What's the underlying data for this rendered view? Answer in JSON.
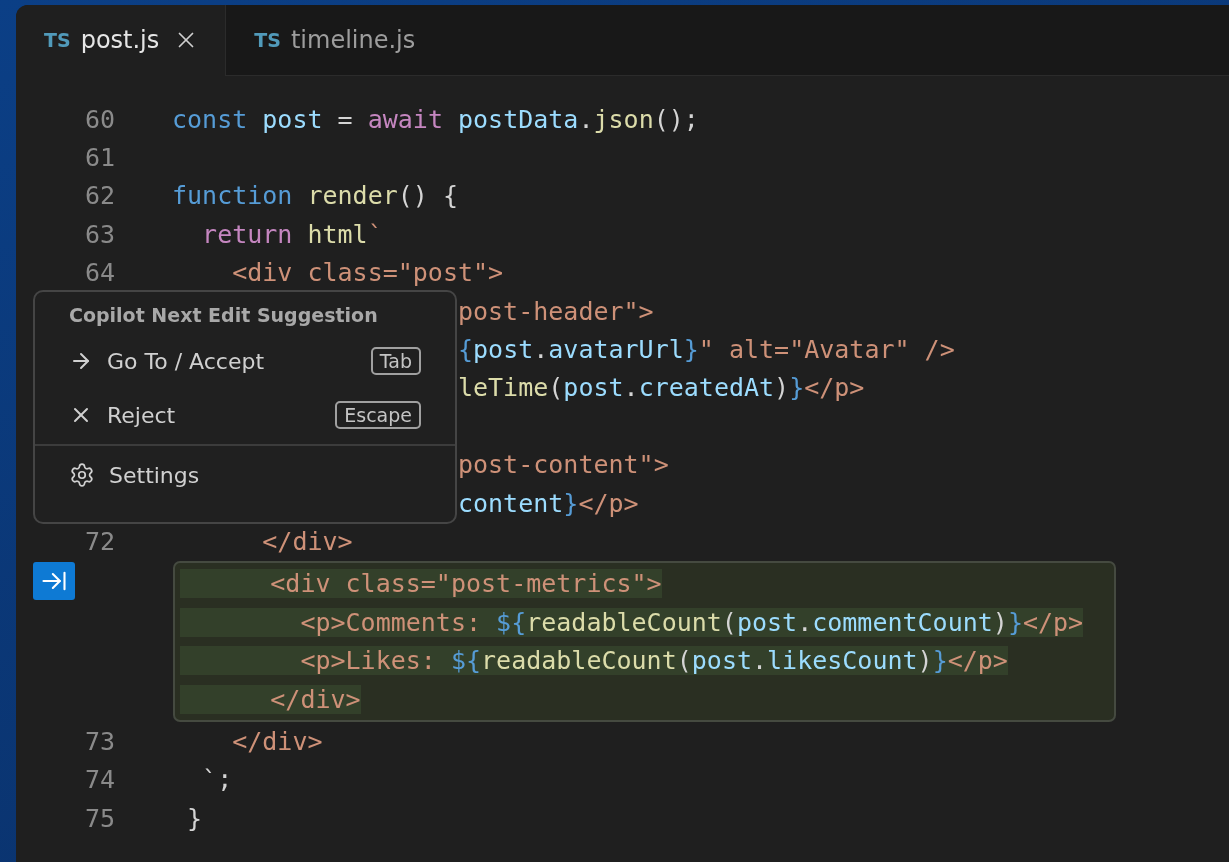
{
  "tabs": [
    {
      "badge": "TS",
      "label": "post.js",
      "selected": true
    },
    {
      "badge": "TS",
      "label": "timeline.js",
      "selected": false
    }
  ],
  "editor": {
    "lines_before": [
      {
        "number": "60",
        "tokens": [
          {
            "t": "const ",
            "color": "#569cd6"
          },
          {
            "t": "post",
            "color": "#9cdcfe"
          },
          {
            "t": " = ",
            "color": "#d4d4d4"
          },
          {
            "t": "await ",
            "color": "#c586c0"
          },
          {
            "t": "postData",
            "color": "#9cdcfe"
          },
          {
            "t": ".",
            "color": "#d4d4d4"
          },
          {
            "t": "json",
            "color": "#dcdcaa"
          },
          {
            "t": "();",
            "color": "#d4d4d4"
          }
        ]
      },
      {
        "number": "61"
      },
      {
        "number": "62",
        "tokens": [
          {
            "t": "function ",
            "color": "#569cd6"
          },
          {
            "t": "render",
            "color": "#dcdcaa"
          },
          {
            "t": "() {",
            "color": "#d4d4d4"
          }
        ]
      },
      {
        "number": "63",
        "tokens": [
          {
            "t": "  return ",
            "color": "#c586c0"
          },
          {
            "t": "html",
            "color": "#dcdcaa"
          },
          {
            "t": "`",
            "color": "#ce9178"
          }
        ]
      },
      {
        "number": "64",
        "tokens": [
          {
            "t": "    <div class=\"post\">",
            "color": "#ce9178"
          }
        ]
      },
      {
        "covered": true,
        "tokens": [
          {
            "t": "post-header\">",
            "color": "#ce9178"
          }
        ]
      },
      {
        "covered": true,
        "tokens": [
          {
            "t": "{",
            "color": "#569cd6"
          },
          {
            "t": "post",
            "color": "#9cdcfe"
          },
          {
            "t": ".",
            "color": "#d4d4d4"
          },
          {
            "t": "avatarUrl",
            "color": "#9cdcfe"
          },
          {
            "t": "}",
            "color": "#569cd6"
          },
          {
            "t": "\" alt=\"Avatar\" />",
            "color": "#ce9178"
          }
        ]
      },
      {
        "covered": true,
        "tokens": [
          {
            "t": "leTime",
            "color": "#dcdcaa"
          },
          {
            "t": "(",
            "color": "#d4d4d4"
          },
          {
            "t": "post",
            "color": "#9cdcfe"
          },
          {
            "t": ".",
            "color": "#d4d4d4"
          },
          {
            "t": "createdAt",
            "color": "#9cdcfe"
          },
          {
            "t": ")",
            "color": "#d4d4d4"
          },
          {
            "t": "}",
            "color": "#569cd6"
          },
          {
            "t": "</p>",
            "color": "#ce9178"
          }
        ]
      },
      {
        "covered": true
      },
      {
        "covered": true,
        "tokens": [
          {
            "t": "post-content\">",
            "color": "#ce9178"
          }
        ]
      },
      {
        "covered": true,
        "tokens": [
          {
            "t": "content",
            "color": "#9cdcfe"
          },
          {
            "t": "}",
            "color": "#569cd6"
          },
          {
            "t": "</p>",
            "color": "#ce9178"
          }
        ]
      },
      {
        "number": "72",
        "tokens": [
          {
            "t": "      </div>",
            "color": "#ce9178"
          }
        ]
      }
    ],
    "suggestion": [
      {
        "tokens": [
          {
            "t": "      <div class=\"post-metrics\">",
            "color": "#ce9178"
          }
        ]
      },
      {
        "tokens": [
          {
            "t": "        <p>Comments: ",
            "color": "#ce9178"
          },
          {
            "t": "${",
            "color": "#569cd6"
          },
          {
            "t": "readableCount",
            "color": "#dcdcaa"
          },
          {
            "t": "(",
            "color": "#d4d4d4"
          },
          {
            "t": "post",
            "color": "#9cdcfe"
          },
          {
            "t": ".",
            "color": "#d4d4d4"
          },
          {
            "t": "commentCount",
            "color": "#9cdcfe"
          },
          {
            "t": ")",
            "color": "#d4d4d4"
          },
          {
            "t": "}",
            "color": "#569cd6"
          },
          {
            "t": "</p>",
            "color": "#ce9178"
          }
        ]
      },
      {
        "tokens": [
          {
            "t": "        <p>Likes: ",
            "color": "#ce9178"
          },
          {
            "t": "${",
            "color": "#569cd6"
          },
          {
            "t": "readableCount",
            "color": "#dcdcaa"
          },
          {
            "t": "(",
            "color": "#d4d4d4"
          },
          {
            "t": "post",
            "color": "#9cdcfe"
          },
          {
            "t": ".",
            "color": "#d4d4d4"
          },
          {
            "t": "likesCount",
            "color": "#9cdcfe"
          },
          {
            "t": ")",
            "color": "#d4d4d4"
          },
          {
            "t": "}",
            "color": "#569cd6"
          },
          {
            "t": "</p>",
            "color": "#ce9178"
          }
        ]
      },
      {
        "tokens": [
          {
            "t": "      </div>",
            "color": "#ce9178"
          }
        ]
      }
    ],
    "lines_after": [
      {
        "number": "73",
        "tokens": [
          {
            "t": "    </div>",
            "color": "#ce9178"
          }
        ]
      },
      {
        "number": "74",
        "tokens": [
          {
            "t": "  `;",
            "color": "#d4d4d4"
          }
        ]
      },
      {
        "number": "75",
        "tokens": [
          {
            "t": " }",
            "color": "#d4d4d4"
          }
        ]
      }
    ]
  },
  "popup": {
    "title": "Copilot Next Edit Suggestion",
    "actions": [
      {
        "kind": "accept",
        "label": "Go To / Accept",
        "key": "Tab"
      },
      {
        "kind": "reject",
        "label": "Reject",
        "key": "Escape"
      }
    ],
    "settings": {
      "label": "Settings"
    }
  }
}
